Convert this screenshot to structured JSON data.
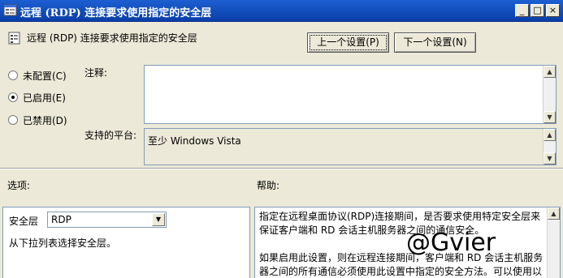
{
  "window": {
    "title": "远程 (RDP) 连接要求使用指定的安全层",
    "controls": {
      "minimize": "_",
      "maximize": "□",
      "close": "×"
    }
  },
  "header": {
    "setting_title": "远程 (RDP) 连接要求使用指定的安全层",
    "prev_button": "上一个设置(P)",
    "next_button": "下一个设置(N)"
  },
  "state_options": {
    "not_configured": "未配置(C)",
    "enabled": "已启用(E)",
    "disabled": "已禁用(D)",
    "selected": "enabled"
  },
  "comment": {
    "label": "注释:",
    "value": ""
  },
  "supported_on": {
    "label": "支持的平台:",
    "value": "至少 Windows Vista"
  },
  "options": {
    "label": "选项:",
    "security_layer_label": "安全层",
    "security_layer_value": "RDP",
    "hint": "从下拉列表选择安全层。"
  },
  "help": {
    "label": "帮助:",
    "paragraph1_line1": "指定在远程桌面协议(RDP)连接期间，是否要求使用特定安全层来",
    "paragraph1_line2": "保证客户端和 RD 会话主机服务器之间的通信安全。",
    "paragraph2_line1": "如果启用此设置，则在远程连接期间，客户端和 RD 会话主机服务",
    "paragraph2_line2": "器之间的所有通信必须使用此设置中指定的安全方法。可以使用以"
  },
  "watermark": "@Gvier",
  "icons": {
    "window": "policy-icon",
    "header": "setting-icon",
    "scroll_up": "up-arrow-icon",
    "scroll_down": "down-arrow-icon",
    "dropdown": "chevron-down-icon"
  }
}
